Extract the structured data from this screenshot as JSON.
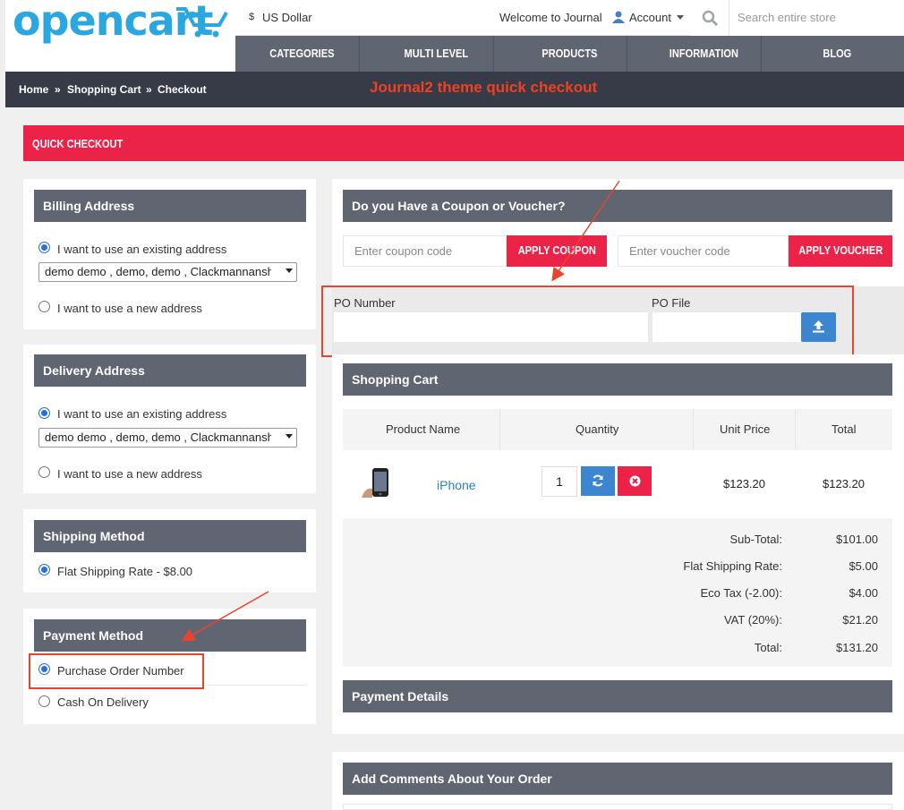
{
  "header": {
    "logo": "opencart",
    "currency_symbol": "$",
    "currency": "US Dollar",
    "welcome": "Welcome to Journal",
    "account": "Account",
    "search_placeholder": "Search entire store"
  },
  "nav": [
    "CATEGORIES",
    "MULTI LEVEL",
    "PRODUCTS",
    "INFORMATION",
    "BLOG"
  ],
  "breadcrumb": [
    "Home",
    "»",
    "Shopping Cart",
    "»",
    "Checkout"
  ],
  "annotation_title": "Journal2 theme quick checkout",
  "page_title": "QUICK CHECKOUT",
  "billing": {
    "title": "Billing Address",
    "existing_label": "I want to use an existing address",
    "selected_address": "demo demo , demo, demo , Clackmannanshire",
    "new_label": "I want to use a new address"
  },
  "delivery": {
    "title": "Delivery Address",
    "existing_label": "I want to use an existing address",
    "selected_address": "demo demo , demo, demo , Clackmannanshire",
    "new_label": "I want to use a new address"
  },
  "shipping": {
    "title": "Shipping Method",
    "option": "Flat Shipping Rate - $8.00"
  },
  "payment": {
    "title": "Payment Method",
    "options": [
      "Purchase Order Number",
      "Cash On Delivery"
    ]
  },
  "coupon": {
    "title": "Do you Have a Coupon or Voucher?",
    "coupon_placeholder": "Enter coupon code",
    "coupon_button": "APPLY COUPON",
    "voucher_placeholder": "Enter voucher code",
    "voucher_button": "APPLY VOUCHER"
  },
  "po": {
    "number_label": "PO Number",
    "file_label": "PO File"
  },
  "cart": {
    "title": "Shopping Cart",
    "columns": [
      "Product Name",
      "Quantity",
      "Unit Price",
      "Total"
    ],
    "item": {
      "name": "iPhone",
      "qty": "1",
      "unit_price": "$123.20",
      "total": "$123.20"
    },
    "totals": [
      {
        "label": "Sub-Total:",
        "value": "$101.00"
      },
      {
        "label": "Flat Shipping Rate:",
        "value": "$5.00"
      },
      {
        "label": "Eco Tax (-2.00):",
        "value": "$4.00"
      },
      {
        "label": "VAT (20%):",
        "value": "$21.20"
      },
      {
        "label": "Total:",
        "value": "$131.20"
      }
    ]
  },
  "payment_details_title": "Payment Details",
  "comments_title": "Add Comments About Your Order",
  "colors": {
    "accent": "#eb2348",
    "heading": "#5f6571",
    "annotation": "#e8452d",
    "link": "#2a7fc0"
  }
}
